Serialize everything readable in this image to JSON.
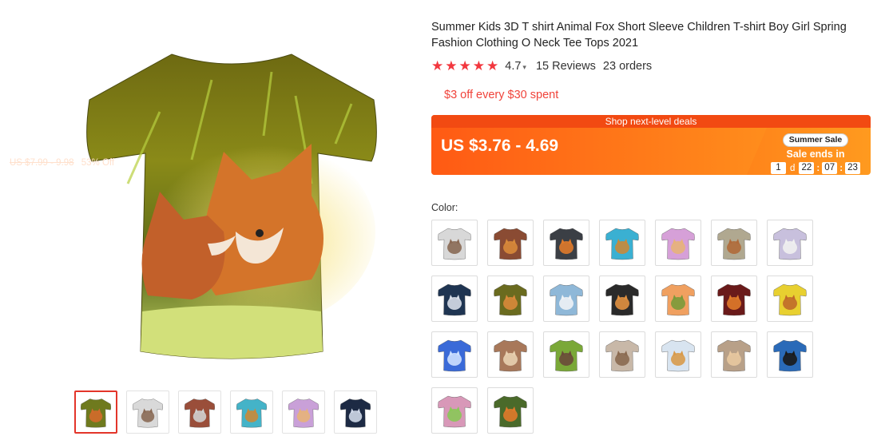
{
  "product": {
    "title": "Summer Kids 3D T shirt Animal Fox Short Sleeve Children T-shirt Boy Girl Spring Fashion Clothing O Neck Tee Tops 2021",
    "rating": "4.7",
    "reviews": "15 Reviews",
    "orders": "23 orders",
    "coupon": "$3 off every $30 spent"
  },
  "deal": {
    "strip_label": "Shop next-level deals",
    "price": "US $3.76 - 4.69",
    "original_price": "US $7.99 - 9.98",
    "discount": "53% Off",
    "sale_pill": "Summer Sale",
    "sale_ends": "Sale ends in",
    "countdown": {
      "days": "1",
      "days_unit": "d",
      "hours": "22",
      "minutes": "07",
      "seconds": "23"
    }
  },
  "colors": {
    "accent": "#f2373e",
    "deal_orange": "#ff7b18",
    "coupon_red": "#f0433a"
  },
  "color_label": "Color:",
  "main_image_icon": "fox-tshirt-image",
  "thumbnails": [
    {
      "icon": "fox-tshirt",
      "body": "#6f7a1e",
      "accent": "#d36a2a"
    },
    {
      "icon": "cat-tshirt",
      "body": "#d9d9d9",
      "accent": "#8a6a55"
    },
    {
      "icon": "wolf-tshirt",
      "body": "#9a4e3a",
      "accent": "#d0d0d0"
    },
    {
      "icon": "fox-tshirt",
      "body": "#44b3c8",
      "accent": "#c98a3a"
    },
    {
      "icon": "fox-tshirt",
      "body": "#c9a0d8",
      "accent": "#e7b27a"
    },
    {
      "icon": "wolf-tshirt",
      "body": "#1d2a44",
      "accent": "#cfd8e8"
    }
  ],
  "swatches": [
    {
      "icon": "cat-tshirt",
      "body": "#d8d8d8",
      "accent": "#8a6a55"
    },
    {
      "icon": "fox-tshirt",
      "body": "#8a4b33",
      "accent": "#d88a3a"
    },
    {
      "icon": "fox-tshirt",
      "body": "#3b3f45",
      "accent": "#e07a2a"
    },
    {
      "icon": "fox-tshirt",
      "body": "#3ab0d2",
      "accent": "#c98a3a"
    },
    {
      "icon": "fox-tshirt",
      "body": "#d6a0d8",
      "accent": "#e7b27a"
    },
    {
      "icon": "fox-tshirt",
      "body": "#b0a890",
      "accent": "#b06a3a"
    },
    {
      "icon": "fox-tshirt",
      "body": "#c8c0dd",
      "accent": "#f0f0f0"
    },
    {
      "icon": "wolf-tshirt",
      "body": "#1f3552",
      "accent": "#d6dde8"
    },
    {
      "icon": "fox-tshirt",
      "body": "#6a6b1f",
      "accent": "#d88a3a"
    },
    {
      "icon": "wolf-tshirt",
      "body": "#8fb8d8",
      "accent": "#eef2f6"
    },
    {
      "icon": "fox-tshirt",
      "body": "#2a2a2a",
      "accent": "#e09040"
    },
    {
      "icon": "fox-tshirt",
      "body": "#f0a060",
      "accent": "#7a9a3a"
    },
    {
      "icon": "fox-tshirt",
      "body": "#6a1a1a",
      "accent": "#e07a2a"
    },
    {
      "icon": "fox-tshirt",
      "body": "#e8d030",
      "accent": "#c06a2a"
    },
    {
      "icon": "wolf-tshirt",
      "body": "#3a6ad8",
      "accent": "#cde0ff"
    },
    {
      "icon": "dog-tshirt",
      "body": "#a8785a",
      "accent": "#e8d0b0"
    },
    {
      "icon": "cat-tshirt",
      "body": "#7aa838",
      "accent": "#6a4a3a"
    },
    {
      "icon": "cat-tshirt",
      "body": "#c8b8a8",
      "accent": "#8a6a50"
    },
    {
      "icon": "cat-tshirt",
      "body": "#d8e4f0",
      "accent": "#d89a4a"
    },
    {
      "icon": "dog-tshirt",
      "body": "#b8a088",
      "accent": "#e8c8a0"
    },
    {
      "icon": "wolf-tshirt",
      "body": "#2a6ab8",
      "accent": "#1a1a1a"
    },
    {
      "icon": "fox-tshirt",
      "body": "#d898b8",
      "accent": "#8ac858"
    },
    {
      "icon": "fox-tshirt",
      "body": "#4a6a2a",
      "accent": "#e07a2a"
    }
  ]
}
